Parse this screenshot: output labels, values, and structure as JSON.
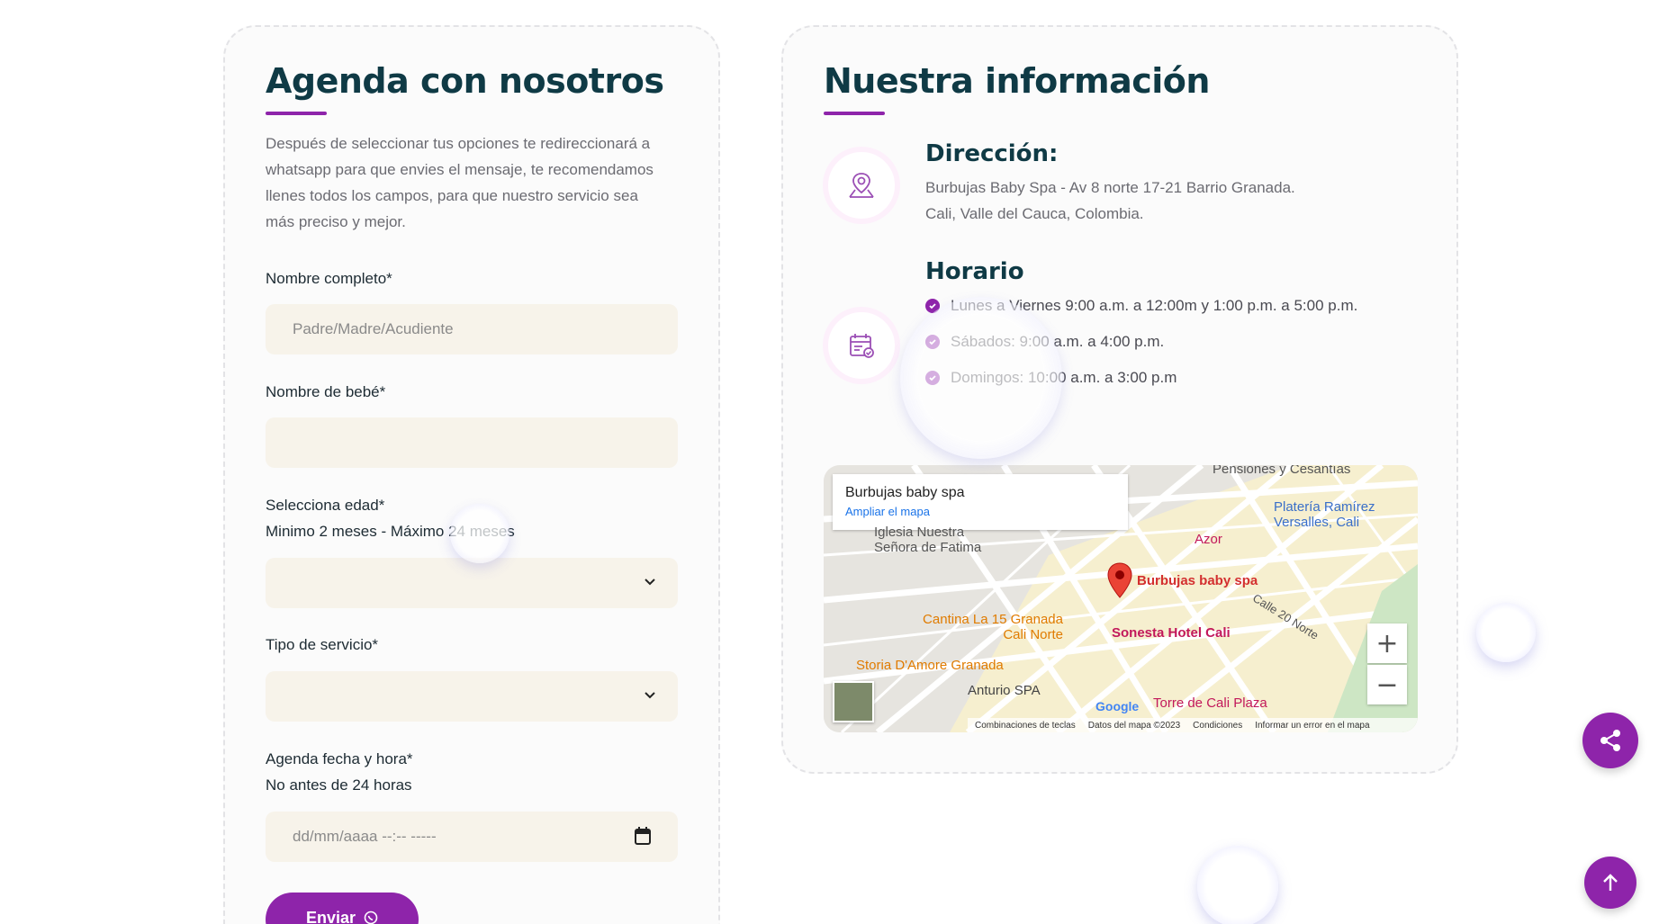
{
  "form": {
    "title": "Agenda con nosotros",
    "description": "Después de seleccionar tus opciones te redireccionará a whatsapp para que envies el mensaje, te recomendamos llenes todos los campos, para que nuestro servicio sea más preciso y mejor.",
    "full_name_label": "Nombre completo*",
    "full_name_placeholder": "Padre/Madre/Acudiente",
    "baby_name_label": "Nombre de bebé*",
    "baby_name_value": "",
    "age_label": "Selecciona edad*",
    "age_hint": "Minimo 2 meses - Máximo 24 meses",
    "age_value": "",
    "service_label": "Tipo de servicio*",
    "service_value": "",
    "date_label": "Agenda fecha y hora*",
    "date_hint": "No antes de 24 horas",
    "date_placeholder": "dd/mm/aaaa --:-- -----",
    "submit_label": "Enviar"
  },
  "info": {
    "title": "Nuestra información",
    "address_heading": "Dirección:",
    "address_line1": "Burbujas Baby Spa - Av 8 norte 17-21 Barrio Granada.",
    "address_line2": "Cali, Valle del Cauca, Colombia.",
    "hours_heading": "Horario",
    "hours": [
      "Lunes a Viernes 9:00 a.m. a 12:00m y 1:00 p.m. a 5:00 p.m.",
      "Sábados: 9:00 a.m. a 4:00 p.m.",
      "Domingos: 10:00 a.m. a 3:00 p.m"
    ]
  },
  "map": {
    "place_name": "Burbujas baby spa",
    "enlarge_link": "Ampliar el mapa",
    "labels": {
      "pensiones": "Pensiones y Cesantías",
      "plateria": "Platería Ramírez Versalles, Cali",
      "iglesia": "Iglesia Nuestra Señora de Fatima",
      "azor": "Azor",
      "marker": "Burbujas baby spa",
      "calle20": "Calle 20 Norte",
      "cantina": "Cantina La 15 Granada Cali Norte",
      "sonesta": "Sonesta Hotel Cali",
      "storia": "Storia D'Amore Granada",
      "anturio": "Anturio SPA",
      "torre": "Torre de Cali Plaza",
      "google": "Google"
    },
    "footer": [
      "Combinaciones de teclas",
      "Datos del mapa ©2023",
      "Condiciones",
      "Informar un error en el mapa"
    ],
    "zoom_in": "+",
    "zoom_out": "−"
  },
  "colors": {
    "accent": "#8e24aa",
    "heading": "#0f3a45",
    "field_bg": "#f7f3ea"
  }
}
